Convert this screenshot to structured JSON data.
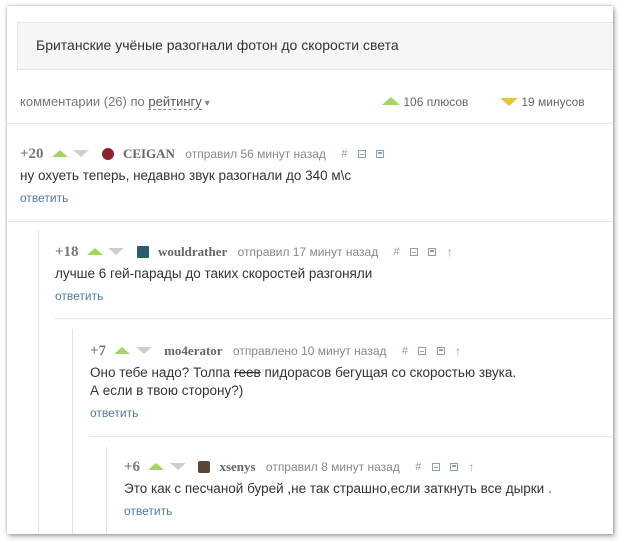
{
  "post": {
    "title": "Британские учёные разогнали фотон до скорости света"
  },
  "toolbar": {
    "comments_label": "комментарии (26) по",
    "sort_value": "рейтингу",
    "plus_count": "106 плюсов",
    "minus_count": "19 минусов"
  },
  "colors": {
    "accent_up": "#a5d46a",
    "accent_down": "#e6c24a",
    "link": "#4f7aa6"
  },
  "icons": [
    "vote-up-icon",
    "vote-down-icon",
    "permalink-icon",
    "collapse-icon",
    "save-icon",
    "parent-arrow-icon"
  ],
  "comments": [
    {
      "rating": "+20",
      "author": "CEIGAN",
      "time": "отправил 56 минут назад",
      "body_lines": [
        "ну охуеть теперь, недавно звук разогнали до 340 м\\с"
      ],
      "reply": "ответить"
    },
    {
      "rating": "+18",
      "author": "wouldrather",
      "time": "отправил 17 минут назад",
      "body_lines": [
        "лучше 6 гей-парады до таких скоростей разгоняли"
      ],
      "reply": "ответить"
    },
    {
      "rating": "+7",
      "author": "mo4erator",
      "time": "отправлено 10 минут назад",
      "body_a": "Оно тебе надо? Толпа ",
      "body_strike": "геев",
      "body_b": " пидорасов бегущая со скоростью звука.",
      "body_line2": "А если в твою сторону?)",
      "reply": "ответить"
    },
    {
      "rating": "+6",
      "author": "xsenys",
      "time": "отправил 8 минут назад",
      "body_lines": [
        "Это как с песчаной бурей ,не так страшно,если заткнуть все дырки ."
      ],
      "reply": "ответить"
    }
  ]
}
